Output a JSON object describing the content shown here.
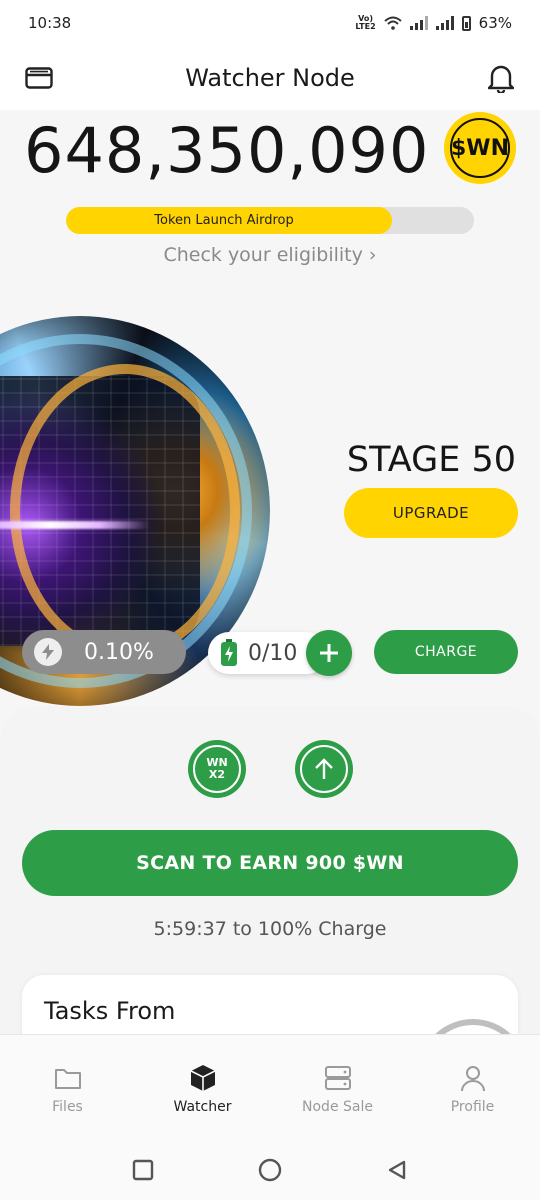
{
  "status_bar": {
    "time": "10:38",
    "volte": "Vo) LTE2",
    "battery_percent": "63%"
  },
  "header": {
    "title": "Watcher Node"
  },
  "balance": {
    "amount": "648,350,090",
    "token_badge": "$WN"
  },
  "airdrop": {
    "label": "Token Launch Airdrop",
    "progress_fraction": 0.8,
    "eligibility_link": "Check your eligibility ›"
  },
  "stage": {
    "label": "STAGE 50",
    "upgrade_label": "UPGRADE"
  },
  "stats": {
    "boost_value": "0.10%",
    "battery_value": "0/10",
    "charge_label": "CHARGE"
  },
  "actions": {
    "wnx2_line1": "WN",
    "wnx2_line2": "X2",
    "scan_label": "SCAN TO EARN 900 $WN",
    "timer_text": "5:59:37 to 100% Charge"
  },
  "tasks": {
    "title": "Tasks From"
  },
  "nav": [
    {
      "label": "Files",
      "icon": "folder-icon"
    },
    {
      "label": "Watcher",
      "icon": "cube-icon"
    },
    {
      "label": "Node Sale",
      "icon": "server-icon"
    },
    {
      "label": "Profile",
      "icon": "user-icon"
    }
  ],
  "colors": {
    "accent_green": "#2e9d47",
    "accent_yellow": "#ffd400"
  }
}
